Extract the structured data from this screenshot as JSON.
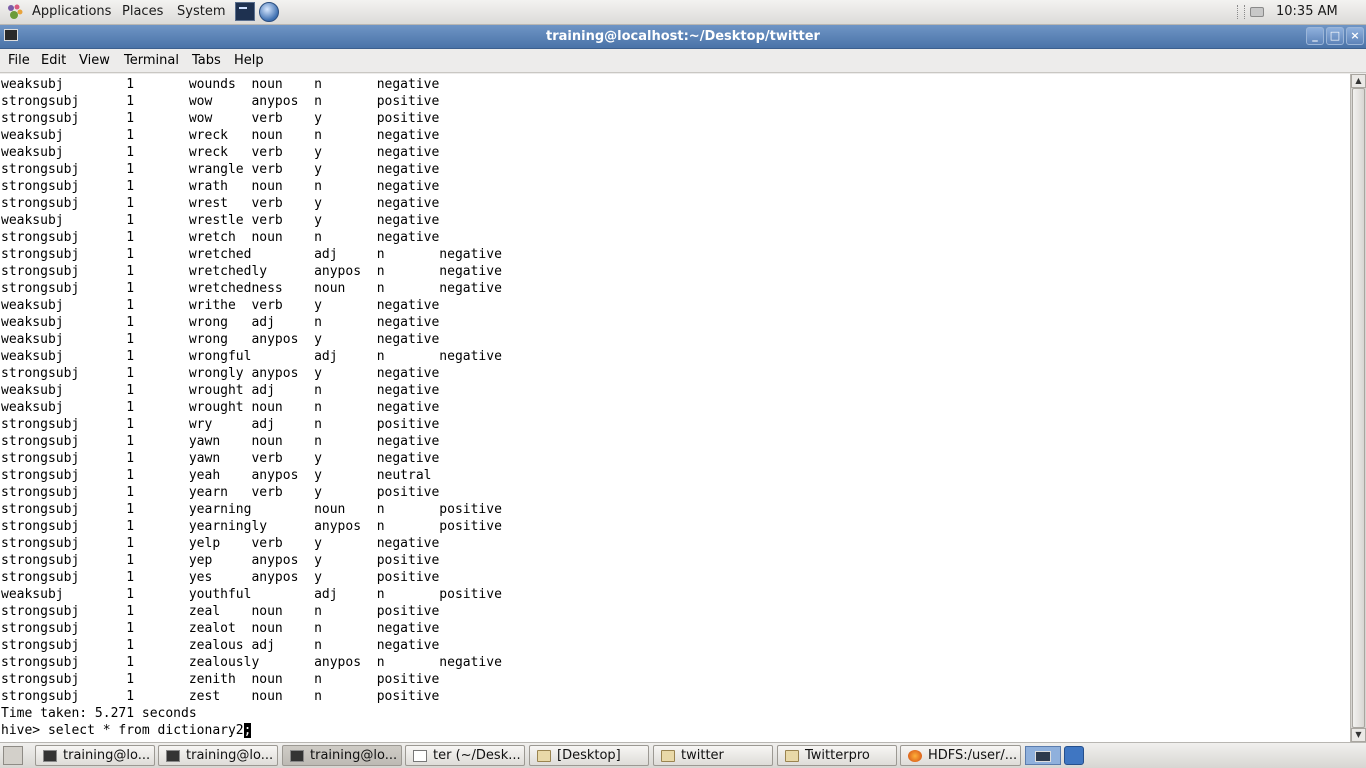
{
  "top_panel": {
    "menus": [
      "Applications",
      "Places",
      "System"
    ],
    "clock": "10:35 AM"
  },
  "window": {
    "title": "training@localhost:~/Desktop/twitter",
    "buttons": [
      "_",
      "□",
      "×"
    ]
  },
  "menubar": [
    "File",
    "Edit",
    "View",
    "Terminal",
    "Tabs",
    "Help"
  ],
  "terminal": {
    "lines": [
      "weaksubj\t1\twounds\tnoun\tn\tnegative",
      "strongsubj\t1\twow\tanypos\tn\tpositive",
      "strongsubj\t1\twow\tverb\ty\tpositive",
      "weaksubj\t1\twreck\tnoun\tn\tnegative",
      "weaksubj\t1\twreck\tverb\ty\tnegative",
      "strongsubj\t1\twrangle\tverb\ty\tnegative",
      "strongsubj\t1\twrath\tnoun\tn\tnegative",
      "strongsubj\t1\twrest\tverb\ty\tnegative",
      "weaksubj\t1\twrestle\tverb\ty\tnegative",
      "strongsubj\t1\twretch\tnoun\tn\tnegative",
      "strongsubj\t1\twretched\tadj\tn\tnegative",
      "strongsubj\t1\twretchedly\tanypos\tn\tnegative",
      "strongsubj\t1\twretchedness\tnoun\tn\tnegative",
      "weaksubj\t1\twrithe\tverb\ty\tnegative",
      "weaksubj\t1\twrong\tadj\tn\tnegative",
      "weaksubj\t1\twrong\tanypos\ty\tnegative",
      "weaksubj\t1\twrongful\tadj\tn\tnegative",
      "strongsubj\t1\twrongly\tanypos\ty\tnegative",
      "weaksubj\t1\twrought\tadj\tn\tnegative",
      "weaksubj\t1\twrought\tnoun\tn\tnegative",
      "strongsubj\t1\twry\tadj\tn\tpositive",
      "strongsubj\t1\tyawn\tnoun\tn\tnegative",
      "strongsubj\t1\tyawn\tverb\ty\tnegative",
      "strongsubj\t1\tyeah\tanypos\ty\tneutral",
      "strongsubj\t1\tyearn\tverb\ty\tpositive",
      "strongsubj\t1\tyearning\tnoun\tn\tpositive",
      "strongsubj\t1\tyearningly\tanypos\tn\tpositive",
      "strongsubj\t1\tyelp\tverb\ty\tnegative",
      "strongsubj\t1\tyep\tanypos\ty\tpositive",
      "strongsubj\t1\tyes\tanypos\ty\tpositive",
      "weaksubj\t1\tyouthful\tadj\tn\tpositive",
      "strongsubj\t1\tzeal\tnoun\tn\tpositive",
      "strongsubj\t1\tzealot\tnoun\tn\tnegative",
      "strongsubj\t1\tzealous\tadj\tn\tnegative",
      "strongsubj\t1\tzealously\tanypos\tn\tnegative",
      "strongsubj\t1\tzenith\tnoun\tn\tpositive",
      "strongsubj\t1\tzest\tnoun\tn\tpositive",
      "Time taken: 5.271 seconds"
    ],
    "prompt": "hive> ",
    "command": "select * from dictionary2",
    "cursor_char": ";"
  },
  "taskbar": {
    "tasks": [
      "training@lo...",
      "training@lo...",
      "training@lo...",
      "ter (~/Desk...",
      "[Desktop]",
      "twitter",
      "Twitterpro",
      "HDFS:/user/..."
    ]
  }
}
